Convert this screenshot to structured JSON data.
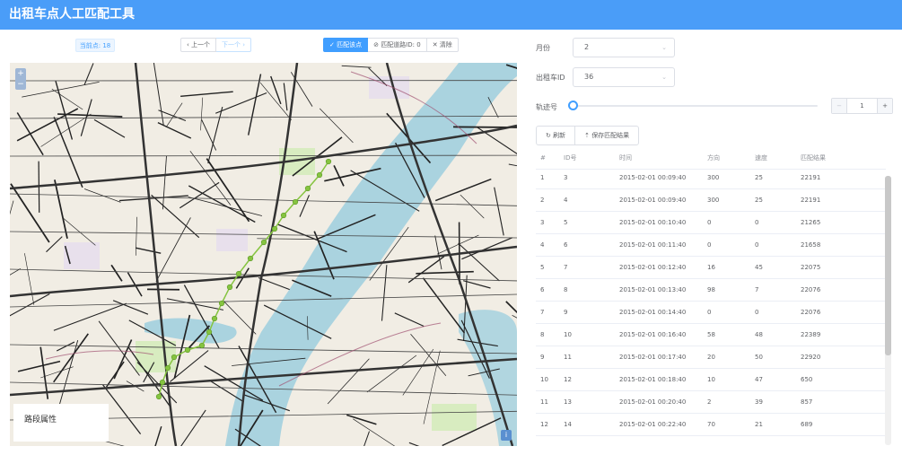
{
  "app": {
    "title": "出租车点人工匹配工具"
  },
  "toolbar": {
    "current_point": "当前点: 18",
    "prev_label": "上一个",
    "next_label": "下一个",
    "match_point_label": "匹配该点",
    "matched_road": "匹配道路ID: 0",
    "clear_label": "清除"
  },
  "map": {
    "zoom_in": "+",
    "zoom_out": "−",
    "road_props_label": "路段属性",
    "info": "i"
  },
  "form": {
    "month_label": "月份",
    "month_value": "2",
    "taxi_label": "出租车ID",
    "taxi_value": "36",
    "track_label": "轨迹号",
    "track_value": "1",
    "track_level": 0
  },
  "actions": {
    "refresh_label": "刷新",
    "save_label": "保存匹配结果"
  },
  "table": {
    "columns": [
      "#",
      "ID号",
      "时间",
      "方向",
      "速度",
      "匹配结果"
    ],
    "rows": [
      [
        "1",
        "3",
        "2015-02-01 00:09:40",
        "300",
        "25",
        "22191"
      ],
      [
        "2",
        "4",
        "2015-02-01 00:09:40",
        "300",
        "25",
        "22191"
      ],
      [
        "3",
        "5",
        "2015-02-01 00:10:40",
        "0",
        "0",
        "21265"
      ],
      [
        "4",
        "6",
        "2015-02-01 00:11:40",
        "0",
        "0",
        "21658"
      ],
      [
        "5",
        "7",
        "2015-02-01 00:12:40",
        "16",
        "45",
        "22075"
      ],
      [
        "6",
        "8",
        "2015-02-01 00:13:40",
        "98",
        "7",
        "22076"
      ],
      [
        "7",
        "9",
        "2015-02-01 00:14:40",
        "0",
        "0",
        "22076"
      ],
      [
        "8",
        "10",
        "2015-02-01 00:16:40",
        "58",
        "48",
        "22389"
      ],
      [
        "9",
        "11",
        "2015-02-01 00:17:40",
        "20",
        "50",
        "22920"
      ],
      [
        "10",
        "12",
        "2015-02-01 00:18:40",
        "10",
        "47",
        "650"
      ],
      [
        "11",
        "13",
        "2015-02-01 00:20:40",
        "2",
        "39",
        "857"
      ],
      [
        "12",
        "14",
        "2015-02-01 00:22:40",
        "70",
        "21",
        "689"
      ]
    ]
  },
  "colors": {
    "header": "#4a9df8",
    "accent": "#409eff",
    "track": "#86c440",
    "river": "#aad3df"
  }
}
